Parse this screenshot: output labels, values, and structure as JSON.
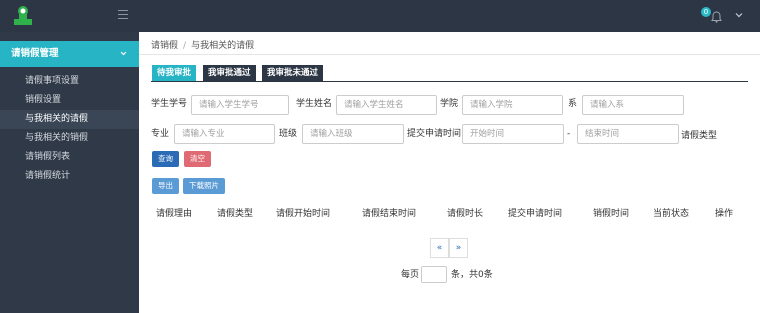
{
  "header": {
    "notification_count": "0"
  },
  "sidebar": {
    "active_group": "请销假管理",
    "items": [
      {
        "label": "请假事项设置"
      },
      {
        "label": "销假设置"
      },
      {
        "label": "与我相关的请假"
      },
      {
        "label": "与我相关的销假"
      },
      {
        "label": "请销假列表"
      },
      {
        "label": "请销假统计"
      }
    ]
  },
  "breadcrumb": {
    "root": "请销假",
    "separator": "/",
    "current": "与我相关的请假"
  },
  "tabs": [
    {
      "label": "待我审批"
    },
    {
      "label": "我审批通过"
    },
    {
      "label": "我审批未通过"
    }
  ],
  "filters": {
    "student_id": {
      "label": "学生学号",
      "placeholder": "请输入学生学号"
    },
    "student_name": {
      "label": "学生姓名",
      "placeholder": "请输入学生姓名"
    },
    "college": {
      "label": "学院",
      "placeholder": "请输入学院"
    },
    "department": {
      "label": "系",
      "placeholder": "请输入系"
    },
    "major": {
      "label": "专业",
      "placeholder": "请输入专业"
    },
    "class": {
      "label": "班级",
      "placeholder": "请输入班级"
    },
    "submit_time": {
      "label": "提交申请时间",
      "start_placeholder": "开始时间",
      "range_sep": "-",
      "end_placeholder": "结束时间"
    },
    "leave_type": {
      "label": "请假类型"
    }
  },
  "actions": {
    "query": "查询",
    "clear": "清空",
    "export": "导出",
    "download_photo": "下载照片"
  },
  "table": {
    "headers": [
      "请假理由",
      "请假类型",
      "请假开始时间",
      "请假结束时间",
      "请假时长",
      "提交申请时间",
      "销假时间",
      "当前状态",
      "操作"
    ]
  },
  "pagination": {
    "prev": "«",
    "next": "»",
    "per_page_label": "每页",
    "per_page_value": "",
    "count_text": "条，共0条"
  },
  "colors": {
    "topbar": "#2c3644",
    "accent": "#27b4c4",
    "primary": "#2b6ab4",
    "danger": "#e06a73"
  }
}
